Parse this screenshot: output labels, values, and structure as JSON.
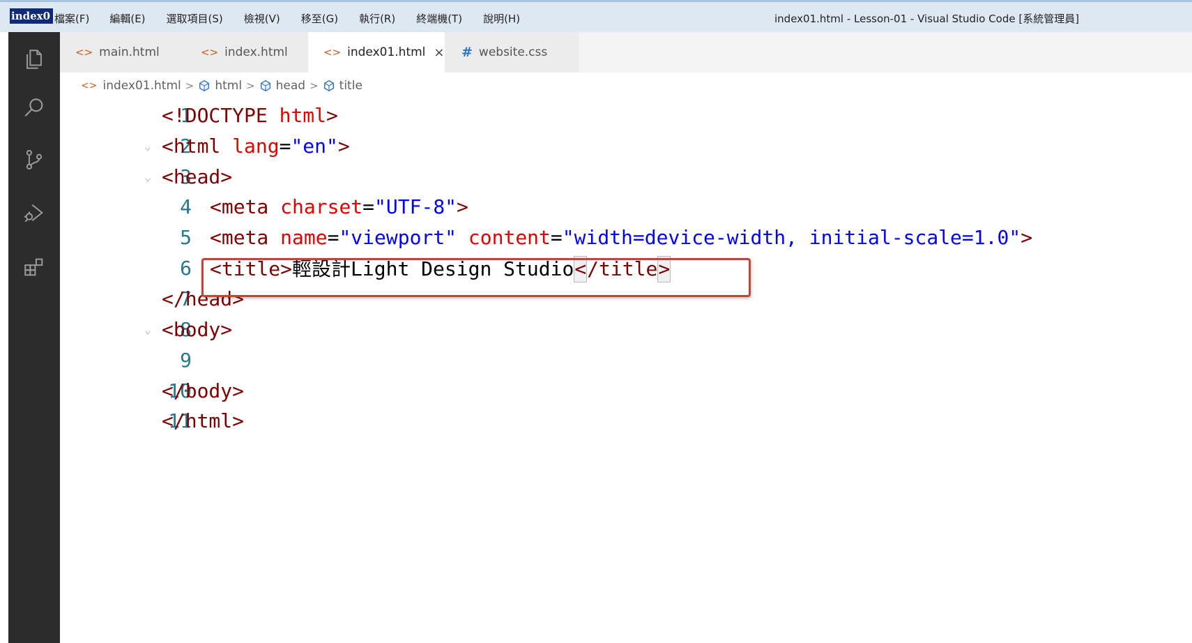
{
  "titlebar": {
    "app_badge": "index0",
    "menu": [
      "檔案(F)",
      "編輯(E)",
      "選取項目(S)",
      "檢視(V)",
      "移至(G)",
      "執行(R)",
      "終端機(T)",
      "說明(H)"
    ],
    "window_title": "index01.html - Lesson-01 - Visual Studio Code [系統管理員]"
  },
  "activitybar": {
    "icons": [
      "explorer-icon",
      "search-icon",
      "source-control-icon",
      "run-debug-icon",
      "extensions-icon"
    ]
  },
  "tabs": [
    {
      "label": "main.html",
      "icon": "html-file-icon",
      "active": false
    },
    {
      "label": "index.html",
      "icon": "html-file-icon",
      "active": false
    },
    {
      "label": "index01.html",
      "icon": "html-file-icon",
      "active": true,
      "close": "×"
    },
    {
      "label": "website.css",
      "icon": "css-file-icon",
      "active": false
    }
  ],
  "breadcrumb": {
    "file": "index01.html",
    "items": [
      "html",
      "head",
      "title"
    ]
  },
  "editor": {
    "line_numbers": [
      "1",
      "2",
      "3",
      "4",
      "5",
      "6",
      "7",
      "8",
      "9",
      "10",
      "11"
    ],
    "lines": {
      "l1": {
        "open": "<!",
        "doctype": "DOCTYPE",
        "kw": "html",
        "close": ">"
      },
      "l2": {
        "open": "<html",
        "attr": "lang",
        "eq": "=",
        "val": "\"en\"",
        "close": ">"
      },
      "l3": {
        "text": "<head>"
      },
      "l4": {
        "open": "<meta",
        "attr": "charset",
        "eq": "=",
        "val": "\"UTF-8\"",
        "close": ">"
      },
      "l5": {
        "open": "<meta",
        "attr1": "name",
        "eq1": "=",
        "val1": "\"viewport\"",
        "attr2": "content",
        "eq2": "=",
        "val2": "\"width=device-width, initial-scale=1.0\"",
        "close": ">"
      },
      "l6": {
        "open": "<title>",
        "content": "輕設計Light Design Studio",
        "close_lt": "<",
        "close_mid": "/title",
        "close_gt": ">"
      },
      "l7": {
        "text": "</head>"
      },
      "l8": {
        "text": "<body>"
      },
      "l9": {
        "text": ""
      },
      "l10": {
        "text": "</body>"
      },
      "l11": {
        "text": "</html>"
      }
    }
  },
  "colors": {
    "tag": "#800000",
    "attribute": "#e50000",
    "string": "#0000ff",
    "line_number": "#237893",
    "highlight_box": "#c0463a"
  }
}
